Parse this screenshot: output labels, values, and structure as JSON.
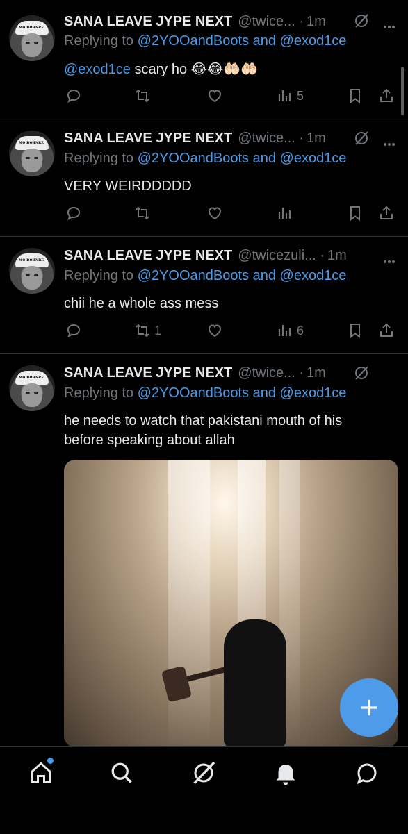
{
  "tweets": [
    {
      "name": "SANA LEAVE JYPE NEXT",
      "handle": "@twice... ·",
      "time": "1m",
      "reply_prefix": "Replying to",
      "reply_user1": "@2YOOandBoots",
      "reply_and": "and",
      "reply_user2": "@exod1ce",
      "mention": "@exod1ce",
      "text": "scary ho 😂😂🤲🏻🤲🏻",
      "retweets": "",
      "likes": "",
      "views": "5"
    },
    {
      "name": "SANA LEAVE JYPE NEXT",
      "handle": "@twice... ·",
      "time": "1m",
      "reply_prefix": "Replying to",
      "reply_user1": "@2YOOandBoots",
      "reply_and": "and",
      "reply_user2": "@exod1ce",
      "text": "VERY WEIRDDDDD",
      "retweets": "",
      "likes": "",
      "views": ""
    },
    {
      "name": "SANA LEAVE JYPE NEXT",
      "handle": "@twicezuli... ·",
      "time": "1m",
      "reply_prefix": "Replying to",
      "reply_user1": "@2YOOandBoots",
      "reply_and": "and",
      "reply_user2": "@exod1ce",
      "text": "chii he a whole ass mess",
      "retweets": "1",
      "likes": "",
      "views": "6"
    },
    {
      "name": "SANA LEAVE JYPE NEXT",
      "handle": "@twice... ·",
      "time": "1m",
      "reply_prefix": "Replying to",
      "reply_user1": "@2YOOandBoots",
      "reply_and": "and",
      "reply_user2": "@exod1ce",
      "text_line1": "he needs to watch that pakistani mouth of his",
      "text_line2": "before speaking about allah"
    }
  ],
  "avatar_cap_text": "ᴍᴏ ʙᴏʜɴʀᴇ",
  "colors": {
    "accent": "#4d9be9",
    "link": "#4c9be8",
    "muted": "#71767b",
    "background": "#000000"
  },
  "icons": {
    "reply": "reply-icon",
    "retweet": "retweet-icon",
    "like": "heart-icon",
    "views": "views-icon",
    "bookmark": "bookmark-icon",
    "share": "share-icon",
    "grok": "grok-icon",
    "more": "more-icon",
    "compose": "plus-icon"
  },
  "tabbar": [
    "home-icon",
    "search-icon",
    "grok-icon",
    "notifications-icon",
    "messages-icon"
  ]
}
